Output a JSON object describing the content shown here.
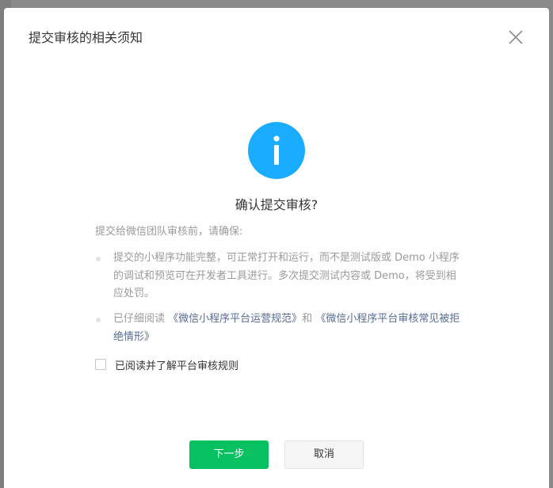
{
  "dialog": {
    "title": "提交审核的相关须知",
    "close_icon": "close-icon",
    "info_icon": "info-icon",
    "accent_color": "#1aadff",
    "confirm_title": "确认提交审核?",
    "intro": "提交给微信团队审核前，请确保:",
    "bullet1": "提交的小程序功能完整，可正常打开和运行，而不是测试版或 Demo 小程序的调试和预览可在开发者工具进行。多次提交测试内容或 Demo，将受到相应处罚。",
    "bullet2_prefix": "已仔细阅读",
    "bullet2_link1": "《微信小程序平台运营规范》",
    "bullet2_and": "和",
    "bullet2_link2": "《微信小程序平台审核常见被拒绝情形》",
    "agree_label": "已阅读并了解平台审核规则",
    "agree_checked": false,
    "next_button": "下一步",
    "cancel_button": "取消",
    "primary_color": "#07c160",
    "link_color": "#576b95"
  }
}
